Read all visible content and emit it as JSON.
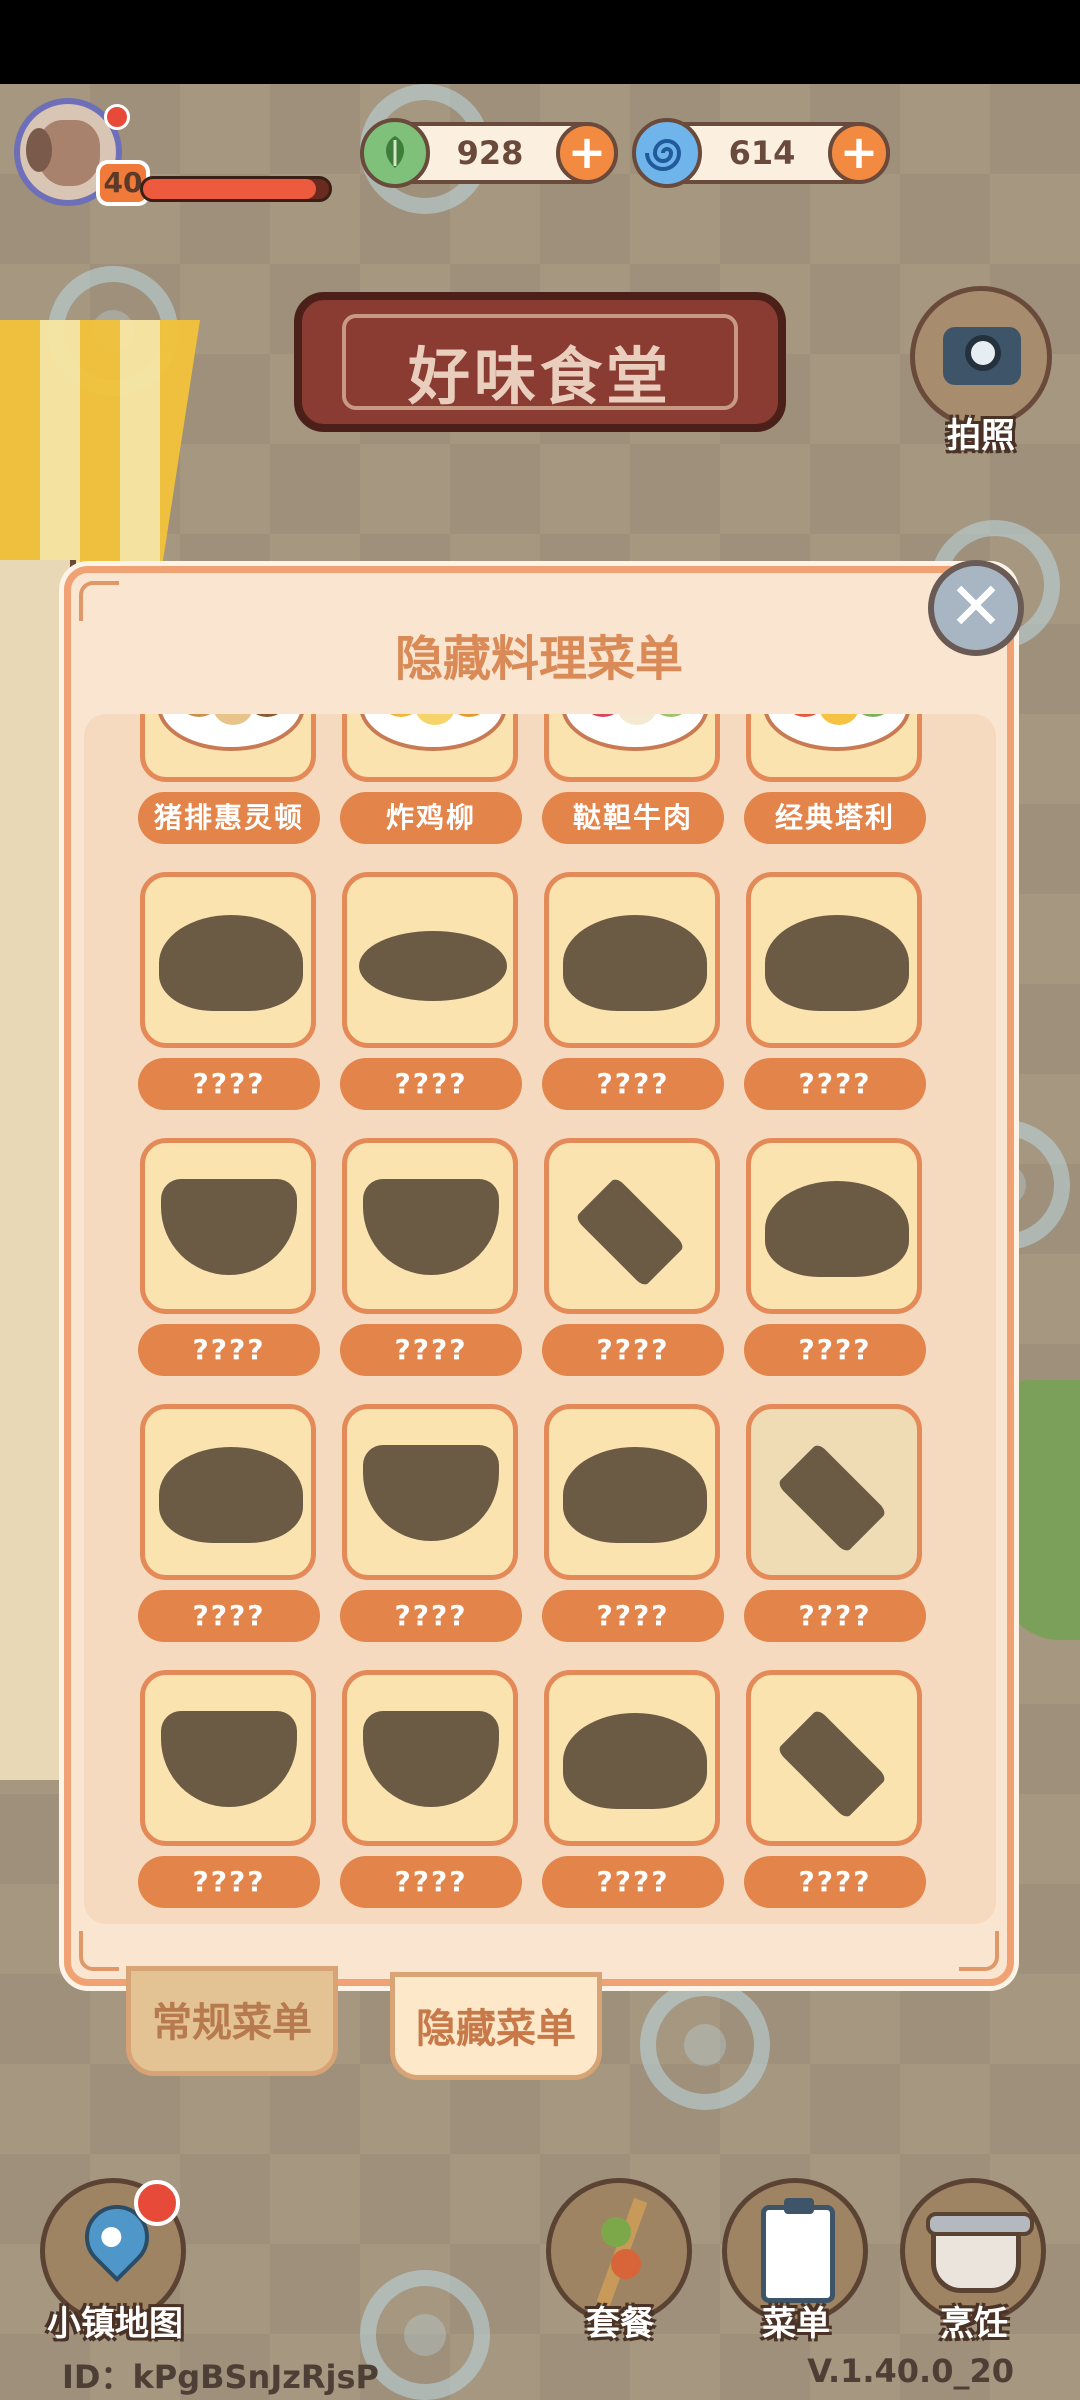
{
  "hud": {
    "level": "40",
    "xp_fraction": 0.93,
    "leaf_currency": "928",
    "swirl_currency": "614",
    "plus_symbol": "+"
  },
  "restaurant_sign": "好味食堂",
  "camera": {
    "label": "拍照"
  },
  "panel": {
    "title": "隐藏料理菜单",
    "close_symbol": "✕"
  },
  "dishes": [
    {
      "name": "猪排惠灵顿",
      "unlocked": true
    },
    {
      "name": "炸鸡柳",
      "unlocked": true
    },
    {
      "name": "鞑靼牛肉",
      "unlocked": true
    },
    {
      "name": "经典塔利",
      "unlocked": true
    },
    {
      "name": "????",
      "unlocked": false
    },
    {
      "name": "????",
      "unlocked": false
    },
    {
      "name": "????",
      "unlocked": false
    },
    {
      "name": "????",
      "unlocked": false
    },
    {
      "name": "????",
      "unlocked": false
    },
    {
      "name": "????",
      "unlocked": false
    },
    {
      "name": "????",
      "unlocked": false
    },
    {
      "name": "????",
      "unlocked": false
    },
    {
      "name": "????",
      "unlocked": false
    },
    {
      "name": "????",
      "unlocked": false
    },
    {
      "name": "????",
      "unlocked": false
    },
    {
      "name": "????",
      "unlocked": false
    },
    {
      "name": "????",
      "unlocked": false
    },
    {
      "name": "????",
      "unlocked": false
    },
    {
      "name": "????",
      "unlocked": false
    },
    {
      "name": "????",
      "unlocked": false
    },
    {
      "name": "????",
      "unlocked": false
    },
    {
      "name": "????",
      "unlocked": false
    },
    {
      "name": "????",
      "unlocked": false
    },
    {
      "name": "????",
      "unlocked": false
    }
  ],
  "tabs": {
    "regular": "常规菜单",
    "hidden": "隐藏菜单",
    "active": "hidden"
  },
  "bottom_nav": {
    "map": "小镇地图",
    "combo": "套餐",
    "menu": "菜单",
    "cook": "烹饪"
  },
  "footer": {
    "id_text": "ID：kPgBSnJzRjsP",
    "version": "V.1.40.0_20"
  },
  "colors": {
    "accent": "#e3844a",
    "panel_bg": "#fae6d0",
    "silhouette": "#6b5b45"
  }
}
